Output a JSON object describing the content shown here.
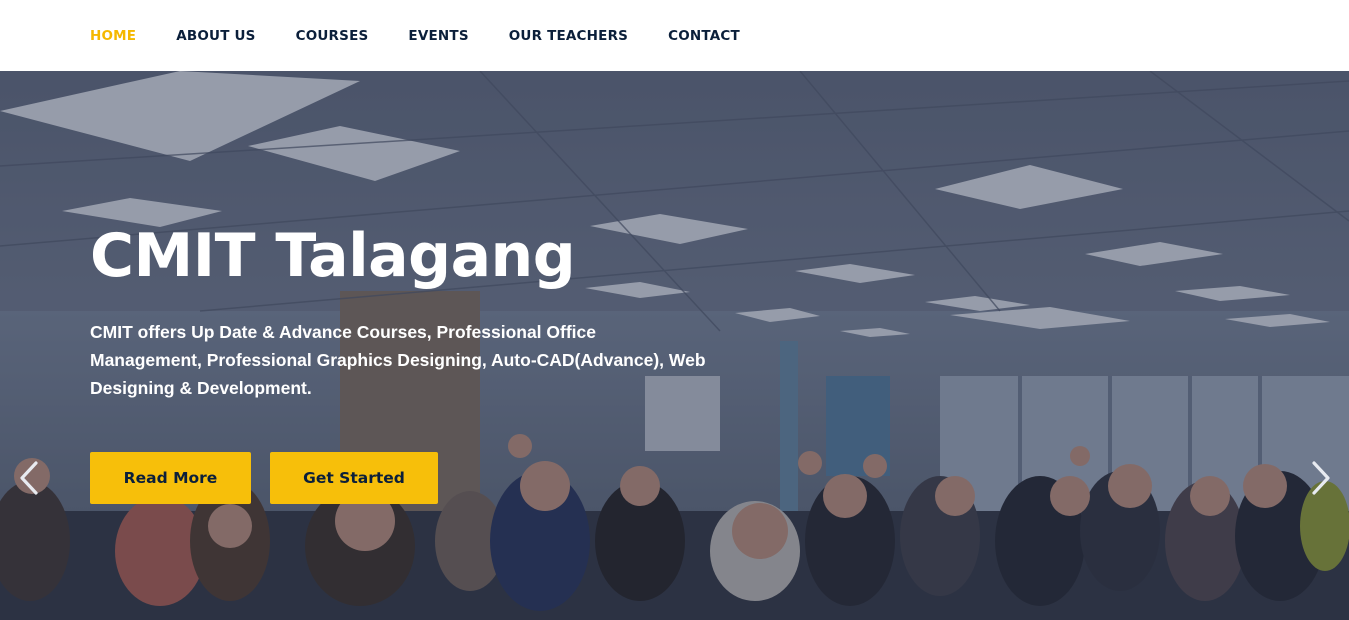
{
  "nav": {
    "items": [
      {
        "label": "HOME",
        "active": true
      },
      {
        "label": "ABOUT US",
        "active": false
      },
      {
        "label": "COURSES",
        "active": false
      },
      {
        "label": "EVENTS",
        "active": false
      },
      {
        "label": "OUR TEACHERS",
        "active": false
      },
      {
        "label": "CONTACT",
        "active": false
      }
    ]
  },
  "hero": {
    "title": "CMIT Talagang",
    "description": "CMIT offers Up Date & Advance Courses, Professional Office Management, Professional Graphics Designing, Auto-CAD(Advance), Web Designing & Development.",
    "read_more_label": "Read More",
    "get_started_label": "Get Started",
    "prev_icon": "chevron-left-icon",
    "next_icon": "chevron-right-icon"
  },
  "colors": {
    "accent": "#f7bf0a",
    "nav_text": "#0b1f3a",
    "nav_active": "#f5b800",
    "hero_text": "#ffffff"
  }
}
